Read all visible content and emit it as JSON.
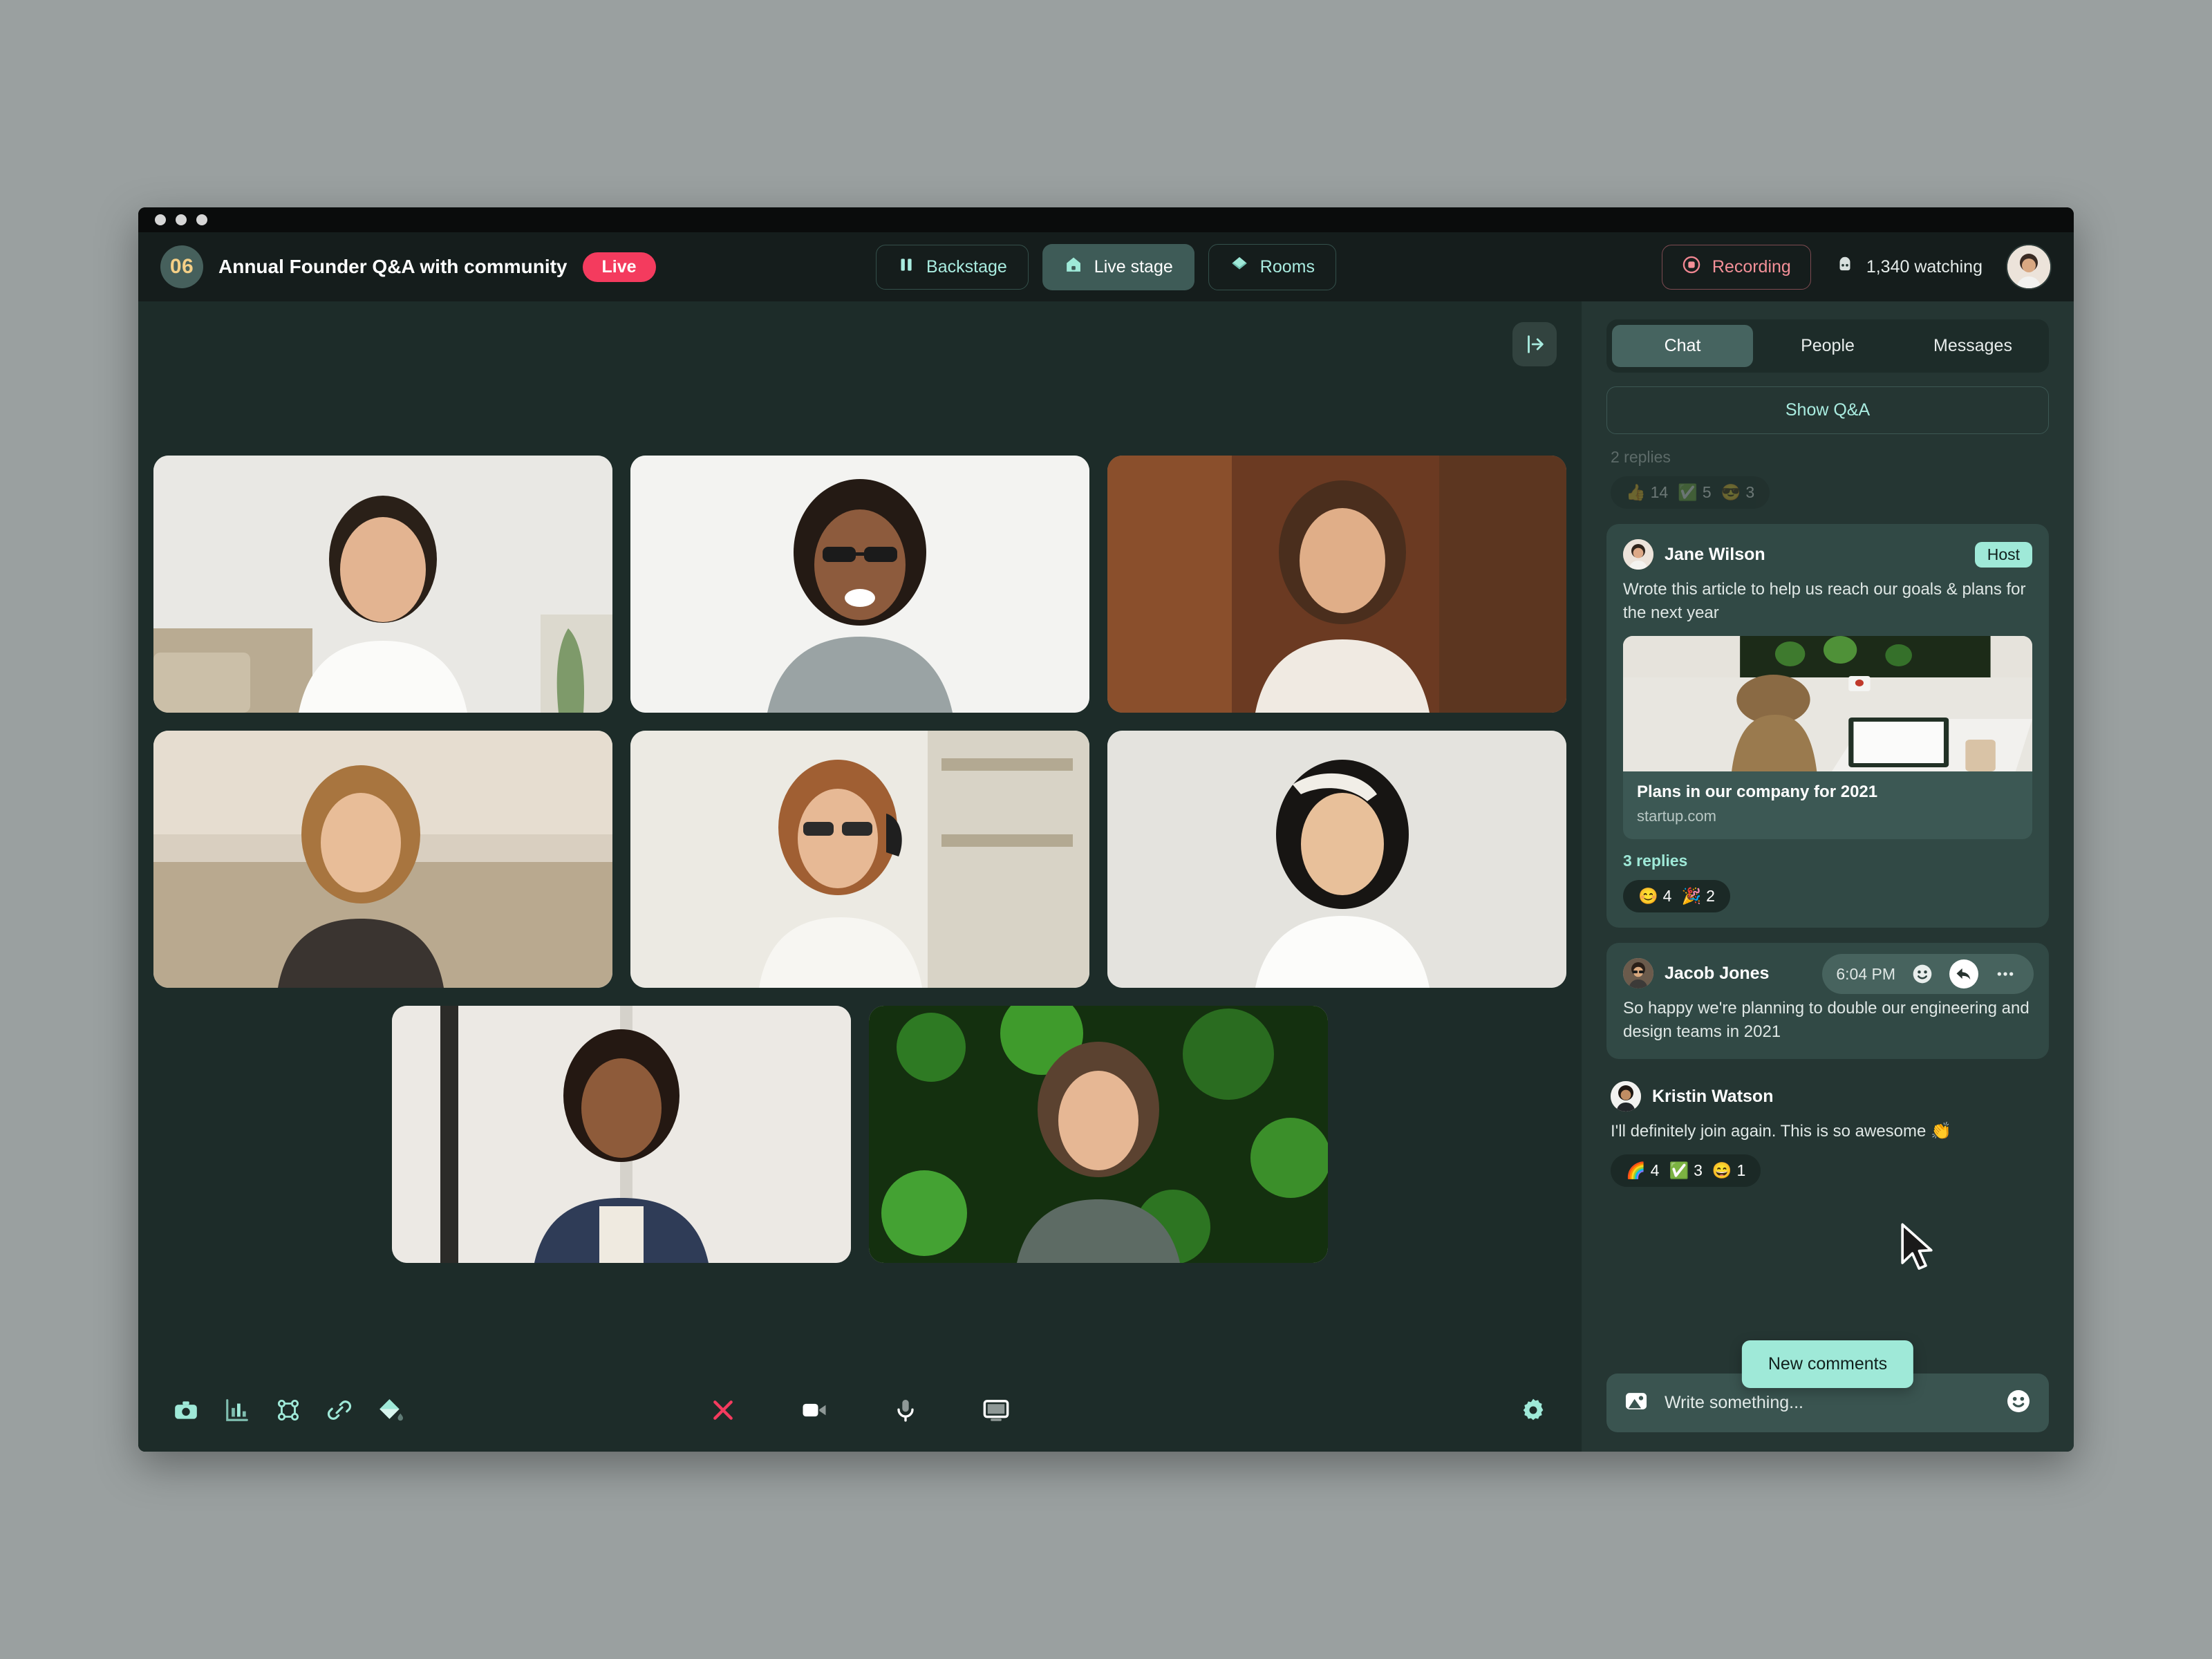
{
  "window": {
    "dots": 3
  },
  "header": {
    "episode_badge": "06",
    "event_title": "Annual Founder Q&A with community",
    "live_label": "Live",
    "nav": [
      {
        "label": "Backstage",
        "icon": "pause-icon",
        "active": false
      },
      {
        "label": "Live stage",
        "icon": "house-icon",
        "active": true
      },
      {
        "label": "Rooms",
        "icon": "diamond-layers-icon",
        "active": false
      }
    ],
    "recording_label": "Recording",
    "watching_label": "1,340 watching"
  },
  "stage": {
    "collapse_icon": "panel-collapse-right-icon",
    "tiles": [
      {
        "name": "participant-tile-1"
      },
      {
        "name": "participant-tile-2"
      },
      {
        "name": "participant-tile-3"
      },
      {
        "name": "participant-tile-4"
      },
      {
        "name": "participant-tile-5"
      },
      {
        "name": "participant-tile-6"
      },
      {
        "name": "participant-tile-7"
      },
      {
        "name": "participant-tile-8"
      }
    ],
    "toolbar_left": [
      "camera-icon",
      "poll-chart-icon",
      "qr-grid-icon",
      "link-icon",
      "color-fill-icon"
    ],
    "controls_center": [
      "leave-call-icon",
      "video-camera-icon",
      "microphone-icon",
      "screen-share-icon"
    ],
    "settings_icon": "gear-icon"
  },
  "chat": {
    "tabs": [
      {
        "label": "Chat",
        "active": true
      },
      {
        "label": "People",
        "active": false
      },
      {
        "label": "Messages",
        "active": false
      }
    ],
    "show_qa_label": "Show Q&A",
    "faded_message": {
      "replies": "2 replies",
      "reactions": [
        {
          "emoji": "👍",
          "count": "14"
        },
        {
          "emoji": "✅",
          "count": "5"
        },
        {
          "emoji": "😎",
          "count": "3"
        }
      ]
    },
    "messages": [
      {
        "author": "Jane Wilson",
        "badge": "Host",
        "text": "Wrote this article to help us reach our goals & plans for the next year",
        "link_card": {
          "title": "Plans in our company for 2021",
          "host": "startup.com"
        },
        "replies": "3 replies",
        "reactions": [
          {
            "emoji": "😊",
            "count": "4"
          },
          {
            "emoji": "🎉",
            "count": "2"
          }
        ]
      },
      {
        "author": "Jacob Jones",
        "time": "6:04 PM",
        "text": "So happy we're planning to double our engineering and design teams in 2021",
        "tools": [
          "emoji-icon",
          "reply-icon",
          "more-options-icon"
        ]
      },
      {
        "author": "Kristin Watson",
        "text": "I'll definitely join again. This is so awesome 👏",
        "reactions": [
          {
            "emoji": "🌈",
            "count": "4"
          },
          {
            "emoji": "✅",
            "count": "3"
          },
          {
            "emoji": "😄",
            "count": "1"
          }
        ]
      }
    ],
    "new_comments_label": "New comments",
    "composer": {
      "image_icon": "image-icon",
      "placeholder": "Write something...",
      "emoji_icon": "smiley-icon"
    }
  },
  "colors": {
    "accent_mint": "#9fe9d8",
    "live_red": "#f43b5e",
    "stage_bg": "#1d2c29",
    "panel_bg": "#253633",
    "header_bg": "#151d1c"
  }
}
